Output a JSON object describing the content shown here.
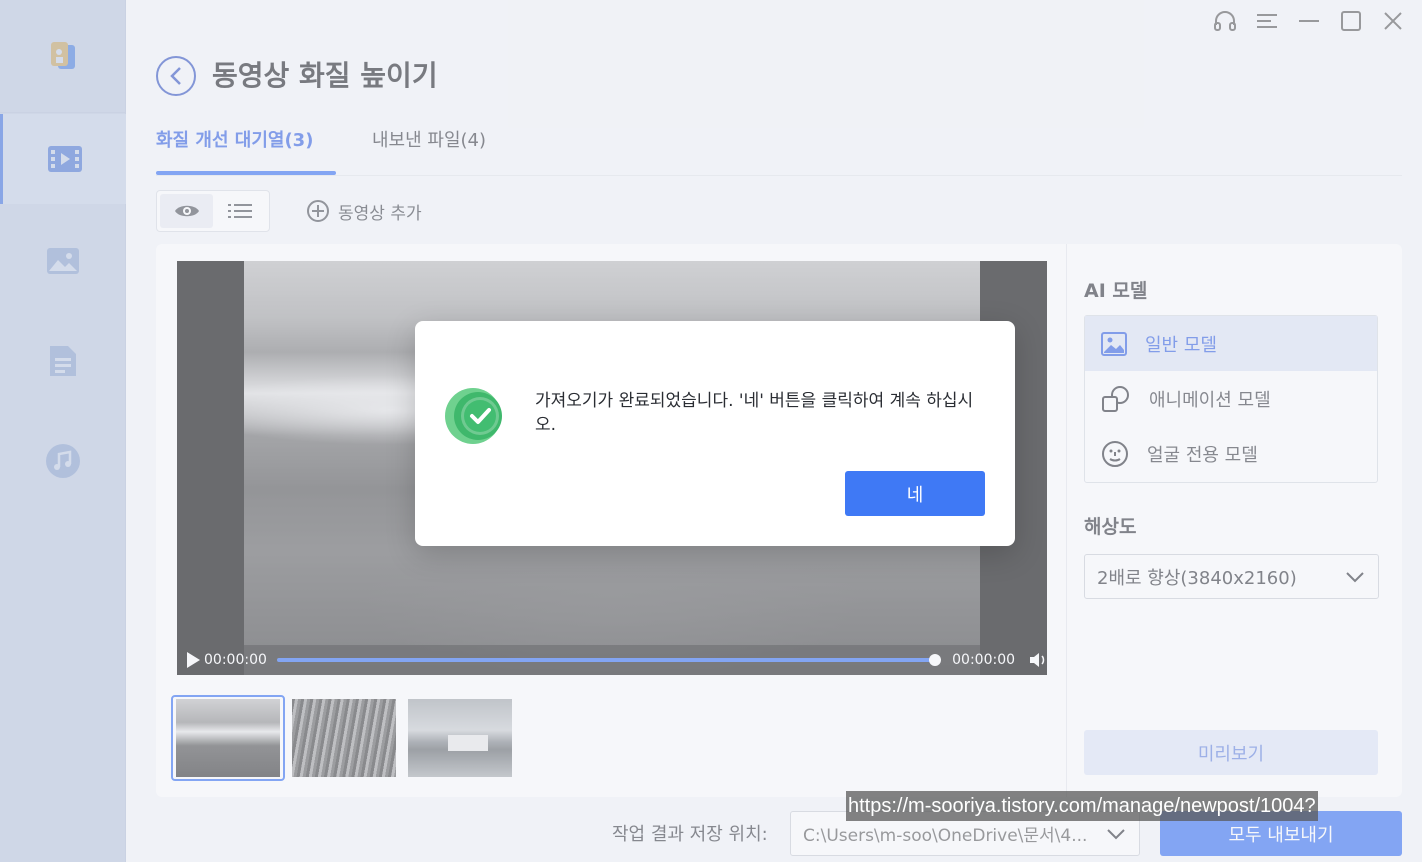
{
  "window": {
    "title": "동영상 화질 높이기",
    "controls": [
      "headset-icon",
      "menu-icon",
      "minimize-icon",
      "maximize-icon",
      "close-icon"
    ]
  },
  "sidebar": {
    "items": [
      {
        "icon": "video-enhance-icon",
        "active": true
      },
      {
        "icon": "image-icon",
        "active": false
      },
      {
        "icon": "document-icon",
        "active": false
      },
      {
        "icon": "music-icon",
        "active": false
      }
    ]
  },
  "tabs": [
    {
      "label": "화질 개선 대기열(3)",
      "active": true
    },
    {
      "label": "내보낸 파일(4)",
      "active": false
    }
  ],
  "toolbar": {
    "add_video_label": "동영상 추가"
  },
  "player": {
    "time_current": "00:00:00",
    "time_total": "00:00:00",
    "progress": 1.0
  },
  "thumbnails": {
    "count": 3,
    "selected_index": 0
  },
  "right_panel": {
    "ai_model_title": "AI 모델",
    "models": [
      {
        "label": "일반 모델",
        "icon": "image-icon",
        "selected": true
      },
      {
        "label": "애니메이션 모델",
        "icon": "shapes-icon",
        "selected": false
      },
      {
        "label": "얼굴 전용 모델",
        "icon": "face-icon",
        "selected": false
      }
    ],
    "resolution_title": "해상도",
    "resolution_value": "2배로 향상(3840x2160)",
    "preview_label": "미리보기"
  },
  "footer": {
    "save_label": "작업 결과 저장 위치:",
    "save_path": "C:\\Users\\m-soo\\OneDrive\\문서\\4...",
    "export_label": "모두 내보내기"
  },
  "dialog": {
    "message": "가져오기가 완료되었습니다. '네' 버튼을 클릭하여 계속 하십시오.",
    "ok_label": "네"
  },
  "watermark_url": "https://m-sooriya.tistory.com/manage/newpost/1004?",
  "colors": {
    "accent": "#2f6bf2",
    "accent_text": "#2d5be0",
    "success": "#4cc47a"
  }
}
